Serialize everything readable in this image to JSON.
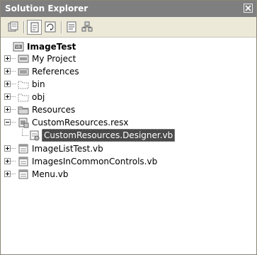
{
  "window": {
    "title": "Solution Explorer",
    "close_label": "✕"
  },
  "toolbar": {
    "buttons": [
      {
        "name": "properties-button",
        "icon": "properties-icon",
        "pressed": false
      },
      {
        "name": "show-all-files-button",
        "icon": "show-all-files-icon",
        "pressed": true
      },
      {
        "name": "refresh-button",
        "icon": "refresh-icon",
        "pressed": false
      },
      {
        "name": "view-code-button",
        "icon": "view-code-icon",
        "pressed": false
      },
      {
        "name": "class-view-button",
        "icon": "class-view-icon",
        "pressed": false
      }
    ]
  },
  "tree": {
    "project": "ImageTest",
    "items": [
      {
        "label": "My Project",
        "icon": "my-project-icon",
        "expander": "collapsed"
      },
      {
        "label": "References",
        "icon": "references-icon",
        "expander": "collapsed"
      },
      {
        "label": "bin",
        "icon": "folder-dashed-icon",
        "expander": "collapsed"
      },
      {
        "label": "obj",
        "icon": "folder-dashed-icon",
        "expander": "collapsed"
      },
      {
        "label": "Resources",
        "icon": "folder-icon",
        "expander": "collapsed"
      },
      {
        "label": "CustomResources.resx",
        "icon": "resx-file-icon",
        "expander": "expanded"
      },
      {
        "label": "CustomResources.Designer.vb",
        "icon": "vb-designer-file-icon",
        "selected": true
      },
      {
        "label": "ImageListTest.vb",
        "icon": "vb-form-icon",
        "expander": "collapsed"
      },
      {
        "label": "ImagesInCommonControls.vb",
        "icon": "vb-form-icon",
        "expander": "collapsed"
      },
      {
        "label": "Menu.vb",
        "icon": "vb-form-icon",
        "expander": "collapsed"
      }
    ]
  }
}
